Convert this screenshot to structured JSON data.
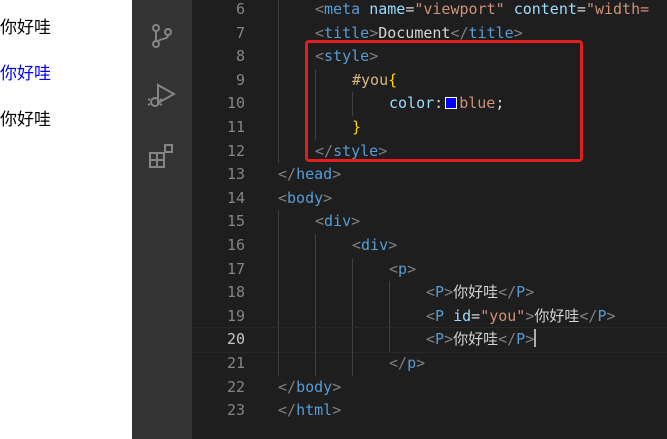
{
  "preview": {
    "lines": [
      {
        "text": "你好哇",
        "color": "#000000"
      },
      {
        "text": "你好哇",
        "color": "#0000ff"
      },
      {
        "text": "你好哇",
        "color": "#000000"
      }
    ]
  },
  "activity_bar": {
    "icons": [
      "source-control-icon",
      "run-debug-icon",
      "extensions-icon"
    ]
  },
  "editor": {
    "active_line": "20",
    "lines": [
      {
        "num": "6",
        "indent": 1,
        "tokens": [
          [
            "br",
            "<"
          ],
          [
            "tag",
            "meta"
          ],
          [
            "txt",
            " "
          ],
          [
            "attr",
            "name"
          ],
          [
            "txt",
            "="
          ],
          [
            "str",
            "\"viewport\""
          ],
          [
            "txt",
            " "
          ],
          [
            "attr",
            "content"
          ],
          [
            "txt",
            "="
          ],
          [
            "str",
            "\"width="
          ]
        ]
      },
      {
        "num": "7",
        "indent": 1,
        "tokens": [
          [
            "br",
            "<"
          ],
          [
            "tag",
            "title"
          ],
          [
            "br",
            ">"
          ],
          [
            "txt",
            "Document"
          ],
          [
            "br",
            "</"
          ],
          [
            "tag",
            "title"
          ],
          [
            "br",
            ">"
          ]
        ]
      },
      {
        "num": "8",
        "indent": 1,
        "tokens": [
          [
            "br",
            "<"
          ],
          [
            "tag",
            "style"
          ],
          [
            "br",
            ">"
          ]
        ]
      },
      {
        "num": "9",
        "indent": 2,
        "tokens": [
          [
            "sel",
            "#you"
          ],
          [
            "brace",
            "{"
          ]
        ]
      },
      {
        "num": "10",
        "indent": 3,
        "tokens": [
          [
            "prop",
            "color"
          ],
          [
            "txt",
            ":"
          ],
          [
            "swatch",
            ""
          ],
          [
            "val",
            "blue"
          ],
          [
            "txt",
            ";"
          ]
        ]
      },
      {
        "num": "11",
        "indent": 2,
        "tokens": [
          [
            "brace",
            "}"
          ]
        ]
      },
      {
        "num": "12",
        "indent": 1,
        "tokens": [
          [
            "br",
            "</"
          ],
          [
            "tag",
            "style"
          ],
          [
            "br",
            ">"
          ]
        ]
      },
      {
        "num": "13",
        "indent": 0,
        "tokens": [
          [
            "br",
            "</"
          ],
          [
            "tag",
            "head"
          ],
          [
            "br",
            ">"
          ]
        ]
      },
      {
        "num": "14",
        "indent": 0,
        "tokens": [
          [
            "br",
            "<"
          ],
          [
            "tag",
            "body"
          ],
          [
            "br",
            ">"
          ]
        ]
      },
      {
        "num": "15",
        "indent": 1,
        "tokens": [
          [
            "br",
            "<"
          ],
          [
            "tag",
            "div"
          ],
          [
            "br",
            ">"
          ]
        ]
      },
      {
        "num": "16",
        "indent": 2,
        "tokens": [
          [
            "br",
            "<"
          ],
          [
            "tag",
            "div"
          ],
          [
            "br",
            ">"
          ]
        ]
      },
      {
        "num": "17",
        "indent": 3,
        "tokens": [
          [
            "br",
            "<"
          ],
          [
            "tag",
            "p"
          ],
          [
            "br",
            ">"
          ]
        ]
      },
      {
        "num": "18",
        "indent": 4,
        "tokens": [
          [
            "br",
            "<"
          ],
          [
            "tag",
            "P"
          ],
          [
            "br",
            ">"
          ],
          [
            "txt",
            "你好哇"
          ],
          [
            "br",
            "</"
          ],
          [
            "tag",
            "P"
          ],
          [
            "br",
            ">"
          ]
        ]
      },
      {
        "num": "19",
        "indent": 4,
        "tokens": [
          [
            "br",
            "<"
          ],
          [
            "tag",
            "P"
          ],
          [
            "txt",
            " "
          ],
          [
            "attr",
            "id"
          ],
          [
            "txt",
            "="
          ],
          [
            "str",
            "\"you\""
          ],
          [
            "br",
            ">"
          ],
          [
            "txt",
            "你好哇"
          ],
          [
            "br",
            "</"
          ],
          [
            "tag",
            "P"
          ],
          [
            "br",
            ">"
          ]
        ]
      },
      {
        "num": "20",
        "indent": 4,
        "tokens": [
          [
            "br",
            "<"
          ],
          [
            "tag",
            "P"
          ],
          [
            "br",
            ">"
          ],
          [
            "txt",
            "你好哇"
          ],
          [
            "br",
            "</"
          ],
          [
            "tag",
            "P"
          ],
          [
            "br",
            ">"
          ],
          [
            "cursor",
            ""
          ]
        ]
      },
      {
        "num": "21",
        "indent": 3,
        "tokens": [
          [
            "br",
            "</"
          ],
          [
            "tag",
            "p"
          ],
          [
            "br",
            ">"
          ]
        ]
      },
      {
        "num": "22",
        "indent": 0,
        "tokens": [
          [
            "br",
            "</"
          ],
          [
            "tag",
            "body"
          ],
          [
            "br",
            ">"
          ]
        ]
      },
      {
        "num": "23",
        "indent": 0,
        "tokens": [
          [
            "br",
            "</"
          ],
          [
            "tag",
            "html"
          ],
          [
            "br",
            ">"
          ]
        ]
      }
    ]
  },
  "colors": {
    "highlight_box": "#e02020",
    "swatch_blue": "#0000ff"
  }
}
